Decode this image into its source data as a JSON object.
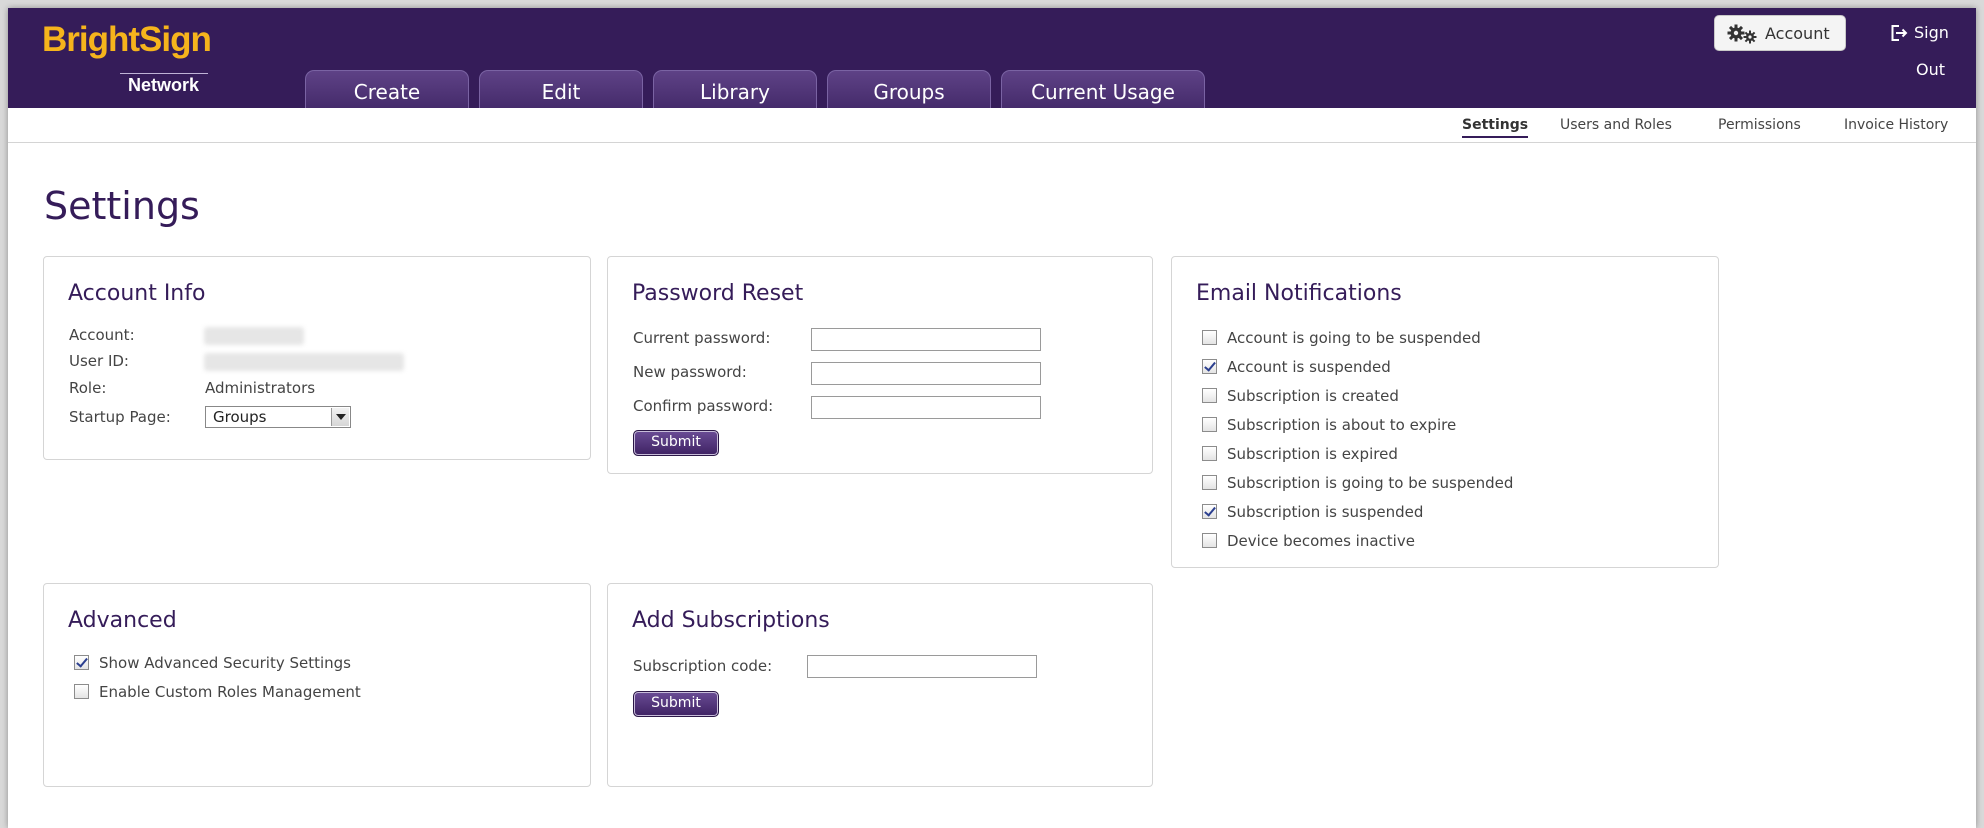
{
  "brand": {
    "logo_bright": "BrightSign",
    "logo_network": "Network"
  },
  "tabs": [
    {
      "label": "Create"
    },
    {
      "label": "Edit"
    },
    {
      "label": "Library"
    },
    {
      "label": "Groups"
    },
    {
      "label": "Current Usage"
    }
  ],
  "header": {
    "account_label": "Account",
    "signout_line1": "Sign",
    "signout_line2": "Out"
  },
  "subnav": [
    {
      "label": "Settings",
      "active": true
    },
    {
      "label": "Users and Roles"
    },
    {
      "label": "Permissions"
    },
    {
      "label": "Invoice History"
    }
  ],
  "page": {
    "title": "Settings"
  },
  "account_info": {
    "title": "Account Info",
    "account_label": "Account:",
    "user_id_label": "User ID:",
    "role_label": "Role:",
    "role_value": "Administrators",
    "startup_label": "Startup Page:",
    "startup_value": "Groups"
  },
  "password_reset": {
    "title": "Password Reset",
    "current_label": "Current password:",
    "new_label": "New password:",
    "confirm_label": "Confirm password:",
    "submit_label": "Submit"
  },
  "email_notifications": {
    "title": "Email Notifications",
    "items": [
      {
        "label": "Account is going to be suspended",
        "checked": false
      },
      {
        "label": "Account is suspended",
        "checked": true
      },
      {
        "label": "Subscription is created",
        "checked": false
      },
      {
        "label": "Subscription is about to expire",
        "checked": false
      },
      {
        "label": "Subscription is expired",
        "checked": false
      },
      {
        "label": "Subscription is going to be suspended",
        "checked": false
      },
      {
        "label": "Subscription is suspended",
        "checked": true
      },
      {
        "label": "Device becomes inactive",
        "checked": false
      }
    ]
  },
  "advanced": {
    "title": "Advanced",
    "items": [
      {
        "label": "Show Advanced Security Settings",
        "checked": true
      },
      {
        "label": "Enable Custom Roles Management",
        "checked": false
      }
    ]
  },
  "add_subscriptions": {
    "title": "Add Subscriptions",
    "code_label": "Subscription code:",
    "submit_label": "Submit"
  },
  "colors": {
    "header_bg": "#351c59",
    "brand_yellow": "#f6b41c",
    "title_purple": "#351c59"
  }
}
